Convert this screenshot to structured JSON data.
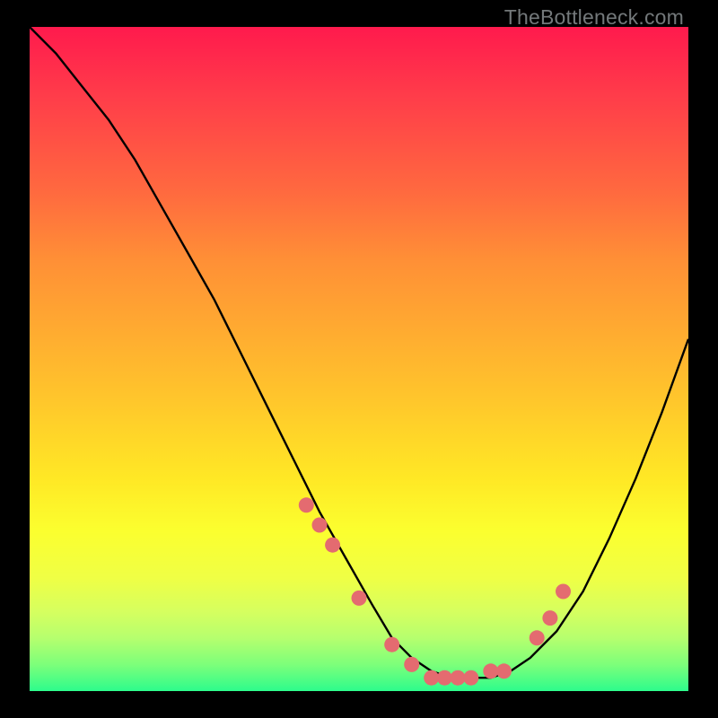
{
  "watermark": "TheBottleneck.com",
  "colors": {
    "background": "#000000",
    "curve": "#000000",
    "marker": "#e46b70",
    "gradient_top": "#ff1a4d",
    "gradient_bottom": "#2dfc8c"
  },
  "chart_data": {
    "type": "line",
    "title": "",
    "xlabel": "",
    "ylabel": "",
    "xlim": [
      0,
      100
    ],
    "ylim": [
      0,
      100
    ],
    "note": "Axis values are estimated (no tick labels present in image). Y represents bottleneck percentage (100 = red/top, 0 = green/bottom).",
    "curve": {
      "x": [
        0,
        4,
        8,
        12,
        16,
        20,
        24,
        28,
        32,
        36,
        40,
        44,
        48,
        52,
        55,
        58,
        61,
        64,
        67,
        70,
        73,
        76,
        80,
        84,
        88,
        92,
        96,
        100
      ],
      "y": [
        100,
        96,
        91,
        86,
        80,
        73,
        66,
        59,
        51,
        43,
        35,
        27,
        20,
        13,
        8,
        5,
        3,
        2,
        2,
        2,
        3,
        5,
        9,
        15,
        23,
        32,
        42,
        53
      ]
    },
    "markers": {
      "comment": "salmon dots shown near the valley",
      "x": [
        42,
        44,
        46,
        50,
        55,
        58,
        61,
        63,
        65,
        67,
        70,
        72,
        77,
        79,
        81
      ],
      "y": [
        28,
        25,
        22,
        14,
        7,
        4,
        2,
        2,
        2,
        2,
        3,
        3,
        8,
        11,
        15
      ]
    }
  }
}
